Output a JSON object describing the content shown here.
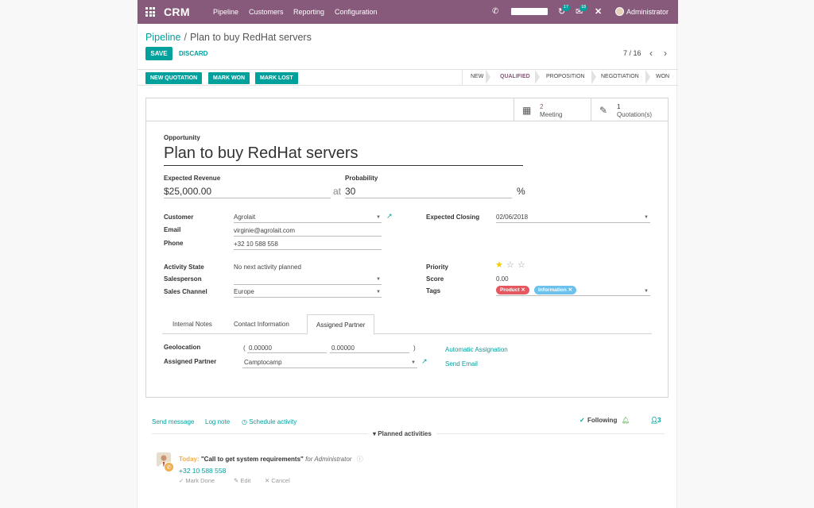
{
  "topbar": {
    "brand": "CRM",
    "menu": [
      "Pipeline",
      "Customers",
      "Reporting",
      "Configuration"
    ],
    "messages_count": "18",
    "activities_count": "17",
    "user": "Administrator"
  },
  "breadcrumb": {
    "parent": "Pipeline",
    "separator": "/",
    "current": "Plan to buy RedHat servers"
  },
  "controls": {
    "save": "SAVE",
    "discard": "DISCARD",
    "pager": "7 / 16"
  },
  "statusbar": {
    "buttons": [
      "NEW QUOTATION",
      "MARK WON",
      "MARK LOST"
    ],
    "stages": [
      "NEW",
      "QUALIFIED",
      "PROPOSITION",
      "NEGOTIATION",
      "WON"
    ],
    "active_stage": "QUALIFIED"
  },
  "smart_buttons": {
    "meeting": {
      "count": "2",
      "label": "Meeting"
    },
    "quotation": {
      "count": "1",
      "label": "Quotation(s)"
    }
  },
  "form": {
    "opportunity_label": "Opportunity",
    "name": "Plan to buy RedHat servers",
    "expected_revenue_label": "Expected Revenue",
    "expected_revenue": "$25,000.00",
    "at": "at",
    "probability_label": "Probability",
    "probability": "30",
    "percent": "%",
    "customer_label": "Customer",
    "customer": "Agrolait",
    "email_label": "Email",
    "email": "virginie@agrolait.com",
    "phone_label": "Phone",
    "phone": "+32 10 588 558",
    "expected_closing_label": "Expected Closing",
    "expected_closing": "02/06/2018",
    "activity_state_label": "Activity State",
    "activity_state": "No next activity planned",
    "salesperson_label": "Salesperson",
    "salesperson": "",
    "sales_channel_label": "Sales Channel",
    "sales_channel": "Europe",
    "priority_label": "Priority",
    "priority_stars": 1,
    "score_label": "Score",
    "score": "0.00",
    "tags_label": "Tags",
    "tags": [
      {
        "name": "Product",
        "color": "#e5585f"
      },
      {
        "name": "Information",
        "color": "#6cc1ed"
      }
    ]
  },
  "tabs": {
    "items": [
      "Internal Notes",
      "Contact Information",
      "Assigned Partner"
    ],
    "active": "Assigned Partner"
  },
  "partner_tab": {
    "geolocation_label": "Geolocation",
    "open_paren": "(",
    "lat": "0.00000",
    "lng": "0.00000",
    "close_paren": ")",
    "assigned_partner_label": "Assigned Partner",
    "assigned_partner": "Camptocamp",
    "automatic_assignation": "Automatic Assignation",
    "send_email": "Send Email"
  },
  "chatter": {
    "send_message": "Send message",
    "log_note": "Log note",
    "schedule_activity": "Schedule activity",
    "following": "Following",
    "followers_count": "3",
    "planned_activities": "Planned activities"
  },
  "activity": {
    "when": "Today:",
    "summary": "\"Call to get system requirements\"",
    "for_text": "for Administrator",
    "phone": "+32 10 588 558",
    "mark_done": "Mark Done",
    "edit": "Edit",
    "cancel": "Cancel"
  },
  "colors": {
    "brand": "#875a7b",
    "accent": "#00a09d",
    "today": "#f0ad4e",
    "star": "#f3cc00"
  }
}
